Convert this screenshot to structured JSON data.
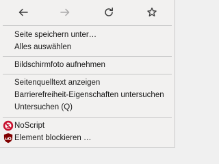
{
  "nav": {
    "buttons": [
      {
        "icon": "back-arrow-icon",
        "enabled": true
      },
      {
        "icon": "forward-arrow-icon",
        "enabled": false
      },
      {
        "icon": "reload-icon",
        "enabled": true
      },
      {
        "icon": "bookmark-star-icon",
        "enabled": true
      }
    ]
  },
  "menu": {
    "save_page": "Seite speichern unter…",
    "select_all": "Alles auswählen",
    "screenshot": "Bildschirmfoto aufnehmen",
    "view_source": "Seitenquelltext anzeigen",
    "inspect_accessibility": "Barrierefreiheit-Eigenschaften untersuchen",
    "inspect": "Untersuchen (Q)",
    "noscript": "NoScript",
    "block_element": "Element blockieren …"
  },
  "colors": {
    "menu_bg": "#f2f1f0",
    "icon_dark": "#3b3b3b",
    "icon_disabled": "#a9a9a9",
    "noscript_red": "#c8102e",
    "ublock_red": "#800000"
  }
}
